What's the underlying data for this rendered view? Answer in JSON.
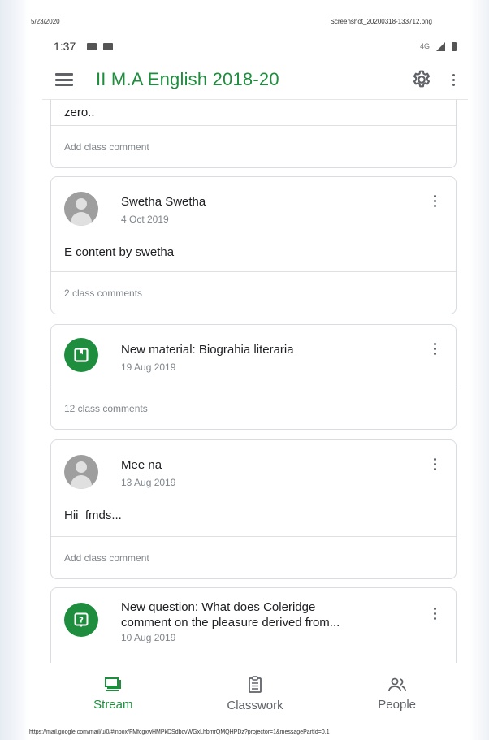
{
  "print": {
    "date": "5/23/2020",
    "filename": "Screenshot_20200318-133712.png",
    "url": "https://mail.google.com/mail/u/0/#inbox/FMfcgxwHMPkDSdbcvWGxLhbmrQMQHPDz?projector=1&messagePartId=0.1"
  },
  "status_bar": {
    "time": "1:37",
    "network": "4G"
  },
  "app_bar": {
    "title": "II M.A English 2018-20"
  },
  "feed": {
    "partial_post": {
      "body": "zero..",
      "footer": "Add class comment"
    },
    "posts": [
      {
        "type": "announcement",
        "author": "Swetha Swetha",
        "date": "4 Oct 2019",
        "body": "E content by swetha",
        "footer": "2 class comments"
      },
      {
        "type": "material",
        "title": "New material: Biograhia literaria",
        "date": "19 Aug 2019",
        "footer": "12 class comments"
      },
      {
        "type": "announcement",
        "author": "Mee na",
        "date": "13 Aug 2019",
        "body": "Hii  fmds...",
        "footer": "Add class comment"
      },
      {
        "type": "question",
        "title_line1": "New question: What does Coleridge",
        "title_line2": "comment on the pleasure derived from...",
        "date": "10 Aug 2019"
      }
    ]
  },
  "bottom_nav": {
    "items": [
      {
        "label": "Stream",
        "icon": "stream-icon",
        "active": true
      },
      {
        "label": "Classwork",
        "icon": "classwork-icon",
        "active": false
      },
      {
        "label": "People",
        "icon": "people-icon",
        "active": false
      }
    ]
  },
  "colors": {
    "accent": "#1e8e3e",
    "secondary_text": "#80868b",
    "divider": "#dadce0"
  }
}
